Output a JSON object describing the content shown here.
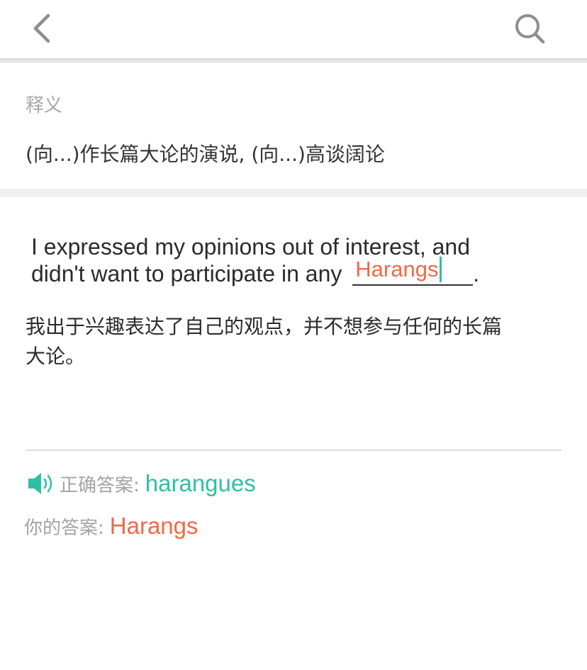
{
  "header": {
    "back_icon": "chevron-left-icon",
    "search_icon": "search-icon"
  },
  "definition": {
    "label": "释义",
    "text": "(向...)作长篇大论的演说, (向...)高谈阔论"
  },
  "exercise": {
    "sentence_before": "I expressed my opinions out of interest, and didn't want to participate in any",
    "sentence_after": ".",
    "input_value": "Harangs",
    "translation": "我出于兴趣表达了自己的观点，并不想参与任何的长篇大论。"
  },
  "result": {
    "speaker_icon": "speaker-icon",
    "correct_label": "正确答案:",
    "correct_answer": "harangues",
    "your_label": "你的答案:",
    "your_answer": "Harangs"
  },
  "colors": {
    "correct": "#2fbfa5",
    "wrong": "#ef6a45",
    "muted": "#a7a7a7"
  }
}
